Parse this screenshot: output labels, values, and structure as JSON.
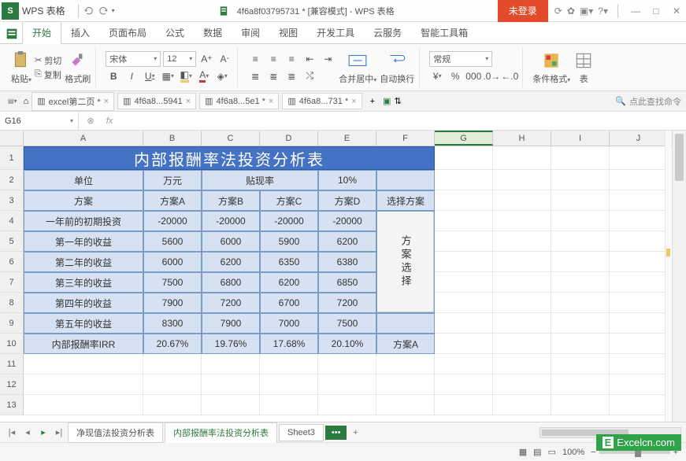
{
  "titlebar": {
    "app_name": "WPS 表格",
    "doc_title": "4f6a8f03795731 * [兼容模式] - WPS 表格",
    "login_badge": "未登录"
  },
  "menu": {
    "tabs": [
      "开始",
      "插入",
      "页面布局",
      "公式",
      "数据",
      "审阅",
      "视图",
      "开发工具",
      "云服务",
      "智能工具箱"
    ],
    "active_index": 0
  },
  "ribbon": {
    "cut": "剪切",
    "copy": "复制",
    "format_painter": "格式刷",
    "paste_label": "粘贴",
    "font_name": "宋体",
    "font_size": "12",
    "bold": "B",
    "italic": "I",
    "underline": "U",
    "merge_center": "合并居中",
    "wrap_text": "自动换行",
    "number_format": "常规",
    "conditional_format": "条件格式",
    "table_format": "表"
  },
  "doc_tabs": {
    "items": [
      {
        "label": "excel第二页 *"
      },
      {
        "label": "4f6a8...5941"
      },
      {
        "label": "4f6a8...5e1 *"
      },
      {
        "label": "4f6a8...731 *"
      }
    ],
    "active_index": 3,
    "search_placeholder": "点此查找命令"
  },
  "formula_bar": {
    "name_box": "G16",
    "fx_label": "fx",
    "formula": ""
  },
  "columns": [
    "A",
    "B",
    "C",
    "D",
    "E",
    "F",
    "G",
    "H",
    "I",
    "J"
  ],
  "row_count": 13,
  "chart_data": {
    "type": "table",
    "title": "内部报酬率法投资分析表",
    "header_unit_label": "单位",
    "header_unit_value": "万元",
    "discount_rate_label": "贴现率",
    "discount_rate_value": "10%",
    "row_header_plan": "方案",
    "plans": [
      "方案A",
      "方案B",
      "方案C",
      "方案D"
    ],
    "select_plan_header": "选择方案",
    "rows": [
      {
        "label": "一年前的初期投资",
        "values": [
          "-20000",
          "-20000",
          "-20000",
          "-20000"
        ]
      },
      {
        "label": "第一年的收益",
        "values": [
          "5600",
          "6000",
          "5900",
          "6200"
        ]
      },
      {
        "label": "第二年的收益",
        "values": [
          "6000",
          "6200",
          "6350",
          "6380"
        ]
      },
      {
        "label": "第三年的收益",
        "values": [
          "7500",
          "6800",
          "6200",
          "6850"
        ]
      },
      {
        "label": "第四年的收益",
        "values": [
          "7900",
          "7200",
          "6700",
          "7200"
        ]
      },
      {
        "label": "第五年的收益",
        "values": [
          "8300",
          "7900",
          "7000",
          "7500"
        ]
      }
    ],
    "irr_label": "内部报酬率IRR",
    "irr_values": [
      "20.67%",
      "19.76%",
      "17.68%",
      "20.10%"
    ],
    "selected_plan": "方案A",
    "scheme_button": "方案选择"
  },
  "sheet_tabs": {
    "items": [
      "净现值法投资分析表",
      "内部报酬率法投资分析表",
      "Sheet3"
    ],
    "active_index": 1
  },
  "status_bar": {
    "zoom": "100%"
  },
  "watermark": "Excelcn.com"
}
